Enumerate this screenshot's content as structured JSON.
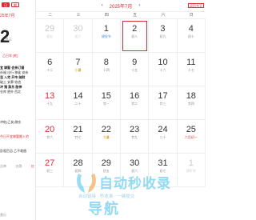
{
  "sidebar": {
    "btn_left": "日",
    "btn_right": "翻",
    "month_label": "25年7月",
    "big_day": "2",
    "weekday": "周三",
    "lunar": "乙巳年 [蛇]",
    "lines": [
      {
        "text": "宜 嫁娶 会亲订婚",
        "bold": true
      },
      {
        "text": "祈福 出行 移徙 安床",
        "bold": false
      },
      {
        "text": "忌 入宅 开市 纳财",
        "bold": true
      },
      {
        "text": "破土 安葬 修造",
        "bold": false
      },
      {
        "text": "冲 猪 煞东 胎神",
        "bold": true
      },
      {
        "text": "仓库 栖外 西北",
        "bold": false
      }
    ],
    "note1": "冲蛇(乙亥)煞东",
    "note2": "今日不宜嫁娶搬入宅",
    "note3": "彭祖百忌 乙不栽植",
    "footer_left": "吉神",
    "footer_mid": "凶煞",
    "footer_right": "红",
    "bottom": "黄历"
  },
  "header": {
    "prev": "‹",
    "title": "2025年7月",
    "next": "›",
    "right_btn": "返回今天"
  },
  "weekdays": [
    "二",
    "三",
    "四",
    "五",
    "六",
    "日"
  ],
  "rows": [
    [
      {
        "num": "29",
        "lunar": "初五",
        "muted": true
      },
      {
        "num": "30",
        "lunar": "初六",
        "muted": true
      },
      {
        "num": "1",
        "lunar": "建党节",
        "lunar_color": "blue"
      },
      {
        "num": "2",
        "lunar": "初八",
        "today": true
      },
      {
        "num": "3",
        "lunar": "初九"
      },
      {
        "num": "4",
        "lunar": "初十"
      }
    ],
    [
      {
        "num": "6",
        "lunar": "十二"
      },
      {
        "num": "7",
        "lunar": "小暑",
        "lunar_color": "orange"
      },
      {
        "num": "8",
        "lunar": "十四"
      },
      {
        "num": "9",
        "lunar": "十五"
      },
      {
        "num": "10",
        "lunar": "十六"
      },
      {
        "num": "11",
        "lunar": "十七"
      }
    ],
    [
      {
        "num": "13",
        "lunar": "十九",
        "num_color": "red"
      },
      {
        "num": "14",
        "lunar": "二十"
      },
      {
        "num": "15",
        "lunar": "廿一"
      },
      {
        "num": "16",
        "lunar": "廿二"
      },
      {
        "num": "17",
        "lunar": "廿三"
      },
      {
        "num": "18",
        "lunar": "廿四"
      }
    ],
    [
      {
        "num": "20",
        "lunar": "廿六",
        "num_color": "red"
      },
      {
        "num": "21",
        "lunar": "廿七"
      },
      {
        "num": "22",
        "lunar": "大暑",
        "lunar_color": "orange"
      },
      {
        "num": "23",
        "lunar": "廿九"
      },
      {
        "num": "24",
        "lunar": "三十"
      },
      {
        "num": "25",
        "lunar": "六月初一",
        "lunar_color": "red"
      }
    ],
    [
      {
        "num": "27",
        "lunar": "初三",
        "num_color": "red"
      },
      {
        "num": "28",
        "lunar": "初四"
      },
      {
        "num": "29",
        "lunar": "初五"
      },
      {
        "num": "30",
        "lunar": "初六"
      },
      {
        "num": "31",
        "lunar": "初七"
      },
      {
        "num": "1",
        "lunar": "建军节",
        "muted": true
      }
    ]
  ],
  "watermark": {
    "title": "自动秒收录",
    "subtitle": "自动链接 · 秒收录 · 一键提交",
    "big": "导航"
  }
}
